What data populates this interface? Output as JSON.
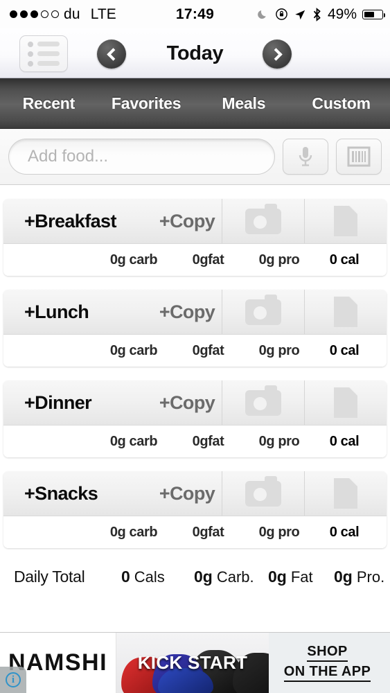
{
  "statusbar": {
    "signal_filled": 3,
    "signal_empty": 2,
    "carrier": "du",
    "network": "LTE",
    "time": "17:49",
    "battery_percent": "49%",
    "icons": [
      "moon-icon",
      "rotation-lock-icon",
      "location-arrow-icon",
      "bluetooth-icon"
    ]
  },
  "navbar": {
    "list_button": "list-icon",
    "prev_button": "chevron-left-icon",
    "next_button": "chevron-right-icon",
    "title": "Today"
  },
  "tabs": [
    {
      "label": "Recent"
    },
    {
      "label": "Favorites"
    },
    {
      "label": "Meals"
    },
    {
      "label": "Custom"
    }
  ],
  "search": {
    "placeholder": "Add food...",
    "value": "",
    "voice_icon": "microphone-icon",
    "barcode_icon": "barcode-icon"
  },
  "meals": [
    {
      "name": "+Breakfast",
      "copy_label": "+Copy",
      "photo_icon": "camera-icon",
      "note_icon": "note-icon",
      "carb": "0g carb",
      "fat": "0gfat",
      "pro": "0g pro",
      "cal": "0 cal"
    },
    {
      "name": "+Lunch",
      "copy_label": "+Copy",
      "photo_icon": "camera-icon",
      "note_icon": "note-icon",
      "carb": "0g carb",
      "fat": "0gfat",
      "pro": "0g pro",
      "cal": "0 cal"
    },
    {
      "name": "+Dinner",
      "copy_label": "+Copy",
      "photo_icon": "camera-icon",
      "note_icon": "note-icon",
      "carb": "0g carb",
      "fat": "0gfat",
      "pro": "0g pro",
      "cal": "0 cal"
    },
    {
      "name": "+Snacks",
      "copy_label": "+Copy",
      "photo_icon": "camera-icon",
      "note_icon": "note-icon",
      "carb": "0g carb",
      "fat": "0gfat",
      "pro": "0g pro",
      "cal": "0 cal"
    }
  ],
  "daily_total": {
    "label": "Daily Total",
    "cals_value": "0",
    "cals_unit": "Cals",
    "carb_value": "0g",
    "carb_unit": "Carb.",
    "fat_value": "0g",
    "fat_unit": "Fat",
    "pro_value": "0g",
    "pro_unit": "Pro."
  },
  "ad": {
    "brand": "NAMSHI",
    "headline": "KICK START",
    "cta_line1": "SHOP",
    "cta_line2": "ON THE APP",
    "info_icon": "info-icon",
    "info_glyph": "i"
  }
}
